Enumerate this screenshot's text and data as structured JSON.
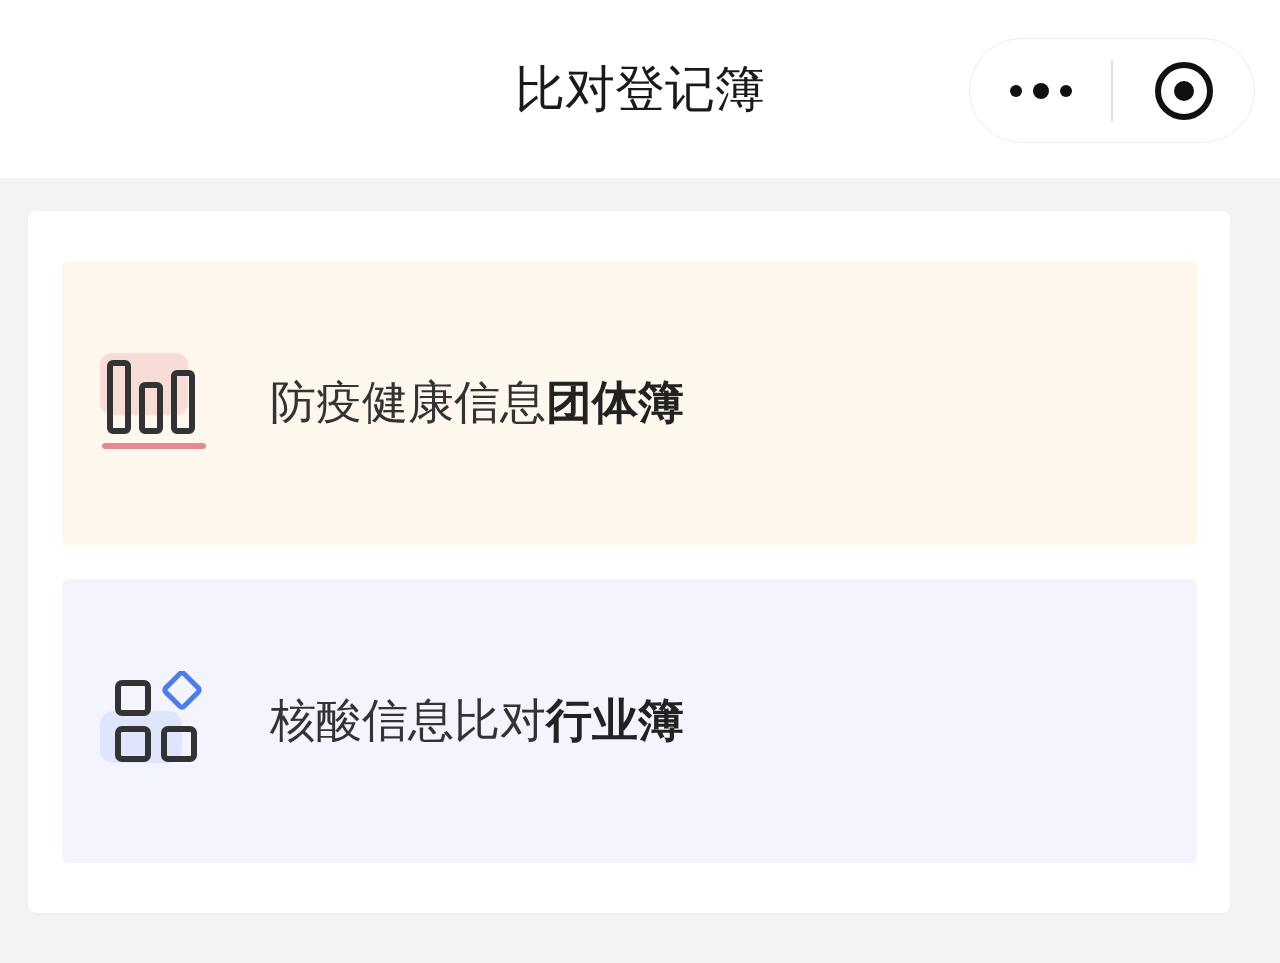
{
  "header": {
    "title": "比对登记簿"
  },
  "entries": [
    {
      "kind": "group",
      "label": "防疫健康信息**团体簿**"
    },
    {
      "kind": "industry",
      "label": "核酸信息比对**行业簿**"
    }
  ]
}
